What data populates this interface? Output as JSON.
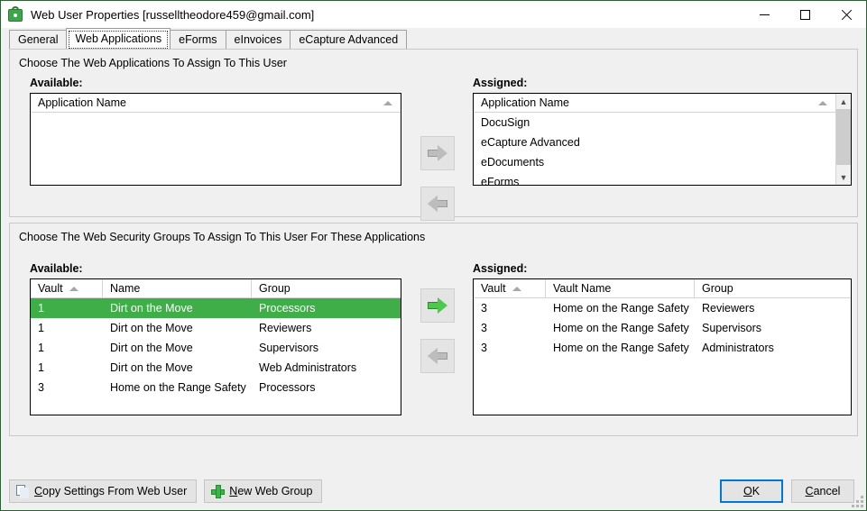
{
  "window": {
    "title": "Web User Properties [russelltheodore459@gmail.com]",
    "icon": "lock-user-icon",
    "controls": {
      "minimize": "minimize-icon",
      "maximize": "maximize-icon",
      "close": "close-icon"
    },
    "accent": "#3fae49",
    "focus_border": "#0078d7"
  },
  "tabs": [
    {
      "label": "General",
      "active": false
    },
    {
      "label": "Web Applications",
      "active": true
    },
    {
      "label": "eForms",
      "active": false
    },
    {
      "label": "eInvoices",
      "active": false
    },
    {
      "label": "eCapture Advanced",
      "active": false
    }
  ],
  "apps_panel": {
    "caption": "Choose The Web Applications To Assign To This User",
    "available_label": "Available:",
    "assigned_label": "Assigned:",
    "available": {
      "columns": [
        "Application Name"
      ],
      "sort_indicator": "sort-ascending-icon",
      "rows": []
    },
    "assigned": {
      "columns": [
        "Application Name"
      ],
      "sort_indicator": "sort-ascending-icon",
      "rows": [
        "DocuSign",
        "eCapture Advanced",
        "eDocuments",
        "eForms"
      ],
      "scrollbar": {
        "up": "chevron-up-icon",
        "down": "chevron-down-icon"
      }
    },
    "add_button": {
      "name": "assign-application-button",
      "enabled": false
    },
    "remove_button": {
      "name": "unassign-application-button",
      "enabled": false
    }
  },
  "groups_panel": {
    "caption": "Choose The Web Security Groups To Assign To This User For These Applications",
    "available_label": "Available:",
    "assigned_label": "Assigned:",
    "available": {
      "columns": [
        "Vault",
        "Name",
        "Group"
      ],
      "sort_column": "Vault",
      "sort_indicator": "sort-ascending-icon",
      "rows": [
        {
          "vault": "1",
          "name": "Dirt on the Move",
          "group": "Processors",
          "selected": true
        },
        {
          "vault": "1",
          "name": "Dirt on the Move",
          "group": "Reviewers",
          "selected": false
        },
        {
          "vault": "1",
          "name": "Dirt on the Move",
          "group": "Supervisors",
          "selected": false
        },
        {
          "vault": "1",
          "name": "Dirt on the Move",
          "group": "Web Administrators",
          "selected": false
        },
        {
          "vault": "3",
          "name": "Home on the Range Safety",
          "group": "Processors",
          "selected": false
        }
      ]
    },
    "assigned": {
      "columns": [
        "Vault",
        "Vault Name",
        "Group"
      ],
      "sort_column": "Vault",
      "sort_indicator": "sort-ascending-icon",
      "rows": [
        {
          "vault": "3",
          "name": "Home on the Range Safety",
          "group": "Reviewers",
          "selected": false
        },
        {
          "vault": "3",
          "name": "Home on the Range Safety",
          "group": "Supervisors",
          "selected": false
        },
        {
          "vault": "3",
          "name": "Home on the Range Safety",
          "group": "Administrators",
          "selected": false
        }
      ]
    },
    "add_button": {
      "name": "assign-group-button",
      "enabled": true
    },
    "remove_button": {
      "name": "unassign-group-button",
      "enabled": false
    }
  },
  "footer": {
    "copy_settings": {
      "label_pre": "",
      "accel": "C",
      "label_post": "opy Settings From Web User",
      "icon": "copy-documents-icon"
    },
    "new_web_group": {
      "accel": "N",
      "label_post": "ew Web Group",
      "icon": "plus-icon"
    },
    "ok": {
      "accel": "O",
      "label_post": "K"
    },
    "cancel": {
      "accel": "C",
      "label_post": "ancel"
    }
  }
}
